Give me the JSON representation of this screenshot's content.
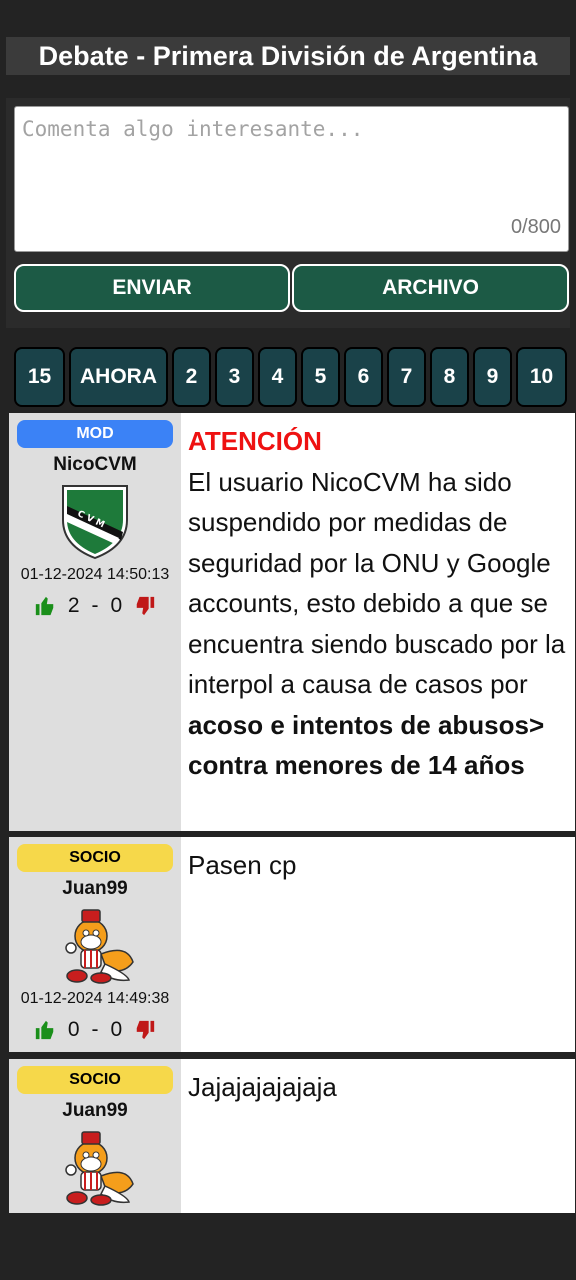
{
  "header": {
    "title": "Debate - Primera División de Argentina"
  },
  "composer": {
    "placeholder": "Comenta algo interesante...",
    "counter": "0/800",
    "send_label": "ENVIAR",
    "file_label": "ARCHIVO"
  },
  "pagination": [
    "15",
    "AHORA",
    "2",
    "3",
    "4",
    "5",
    "6",
    "7",
    "8",
    "9",
    "10"
  ],
  "posts": [
    {
      "badge": "MOD",
      "user": "NicoCVM",
      "avatar": "club-crest-cvm-icon",
      "timestamp": "01-12-2024 14:50:13",
      "likes": "2",
      "sep": "-",
      "dislikes": "0",
      "title": "ATENCIÓN",
      "text": "El usuario NicoCVM ha sido suspendido por medidas de seguridad por la ONU y Google accounts, esto debido a que se encuentra siendo buscado por la interpol a causa de casos por ",
      "bold": "acoso e intentos de abusos> contra menores de 14 años"
    },
    {
      "badge": "SOCIO",
      "user": "Juan99",
      "avatar": "fox-character-icon",
      "timestamp": "01-12-2024 14:49:38",
      "likes": "0",
      "sep": "-",
      "dislikes": "0",
      "text": "Pasen cp"
    },
    {
      "badge": "SOCIO",
      "user": "Juan99",
      "avatar": "fox-character-icon",
      "text": "Jajajajajajaja"
    }
  ],
  "colors": {
    "send_button": "#1c5a45",
    "page_button": "#1a4249",
    "mod_badge": "#3b82f6",
    "socio_badge": "#f6d84a",
    "alert": "#ee1111"
  }
}
